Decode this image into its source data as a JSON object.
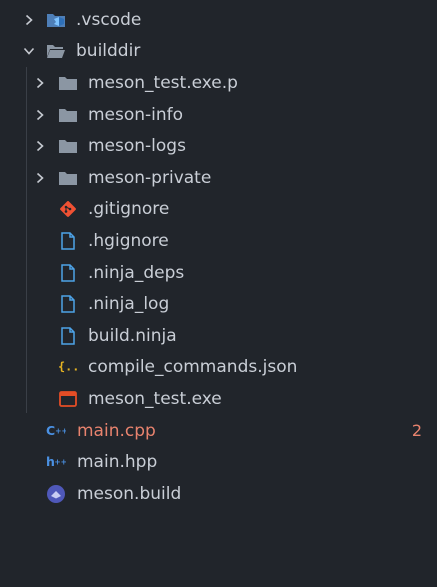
{
  "explorer": {
    "items": [
      {
        "label": ".vscode",
        "icon": "vscode-folder-icon"
      },
      {
        "label": "builddir",
        "icon": "folder-open-icon"
      },
      {
        "label": "meson_test.exe.p",
        "icon": "folder-icon"
      },
      {
        "label": "meson-info",
        "icon": "folder-icon"
      },
      {
        "label": "meson-logs",
        "icon": "folder-icon"
      },
      {
        "label": "meson-private",
        "icon": "folder-icon"
      },
      {
        "label": ".gitignore",
        "icon": "git-icon"
      },
      {
        "label": ".hgignore",
        "icon": "file-icon"
      },
      {
        "label": ".ninja_deps",
        "icon": "file-icon"
      },
      {
        "label": ".ninja_log",
        "icon": "file-icon"
      },
      {
        "label": "build.ninja",
        "icon": "file-icon"
      },
      {
        "label": "compile_commands.json",
        "icon": "json-icon"
      },
      {
        "label": "meson_test.exe",
        "icon": "exe-icon"
      },
      {
        "label": "main.cpp",
        "icon": "cpp-icon",
        "badge": "2"
      },
      {
        "label": "main.hpp",
        "icon": "hpp-icon"
      },
      {
        "label": "meson.build",
        "icon": "meson-icon"
      }
    ]
  },
  "colors": {
    "background": "#21252b",
    "text": "#c9ced6",
    "modified": "#e8836e",
    "folder": "#8b96a3",
    "file": "#4da3e8",
    "json": "#e6b422",
    "git": "#f05133",
    "exe": "#e44d26",
    "cpp": "#4a90e2",
    "meson": "#4f58b9"
  }
}
